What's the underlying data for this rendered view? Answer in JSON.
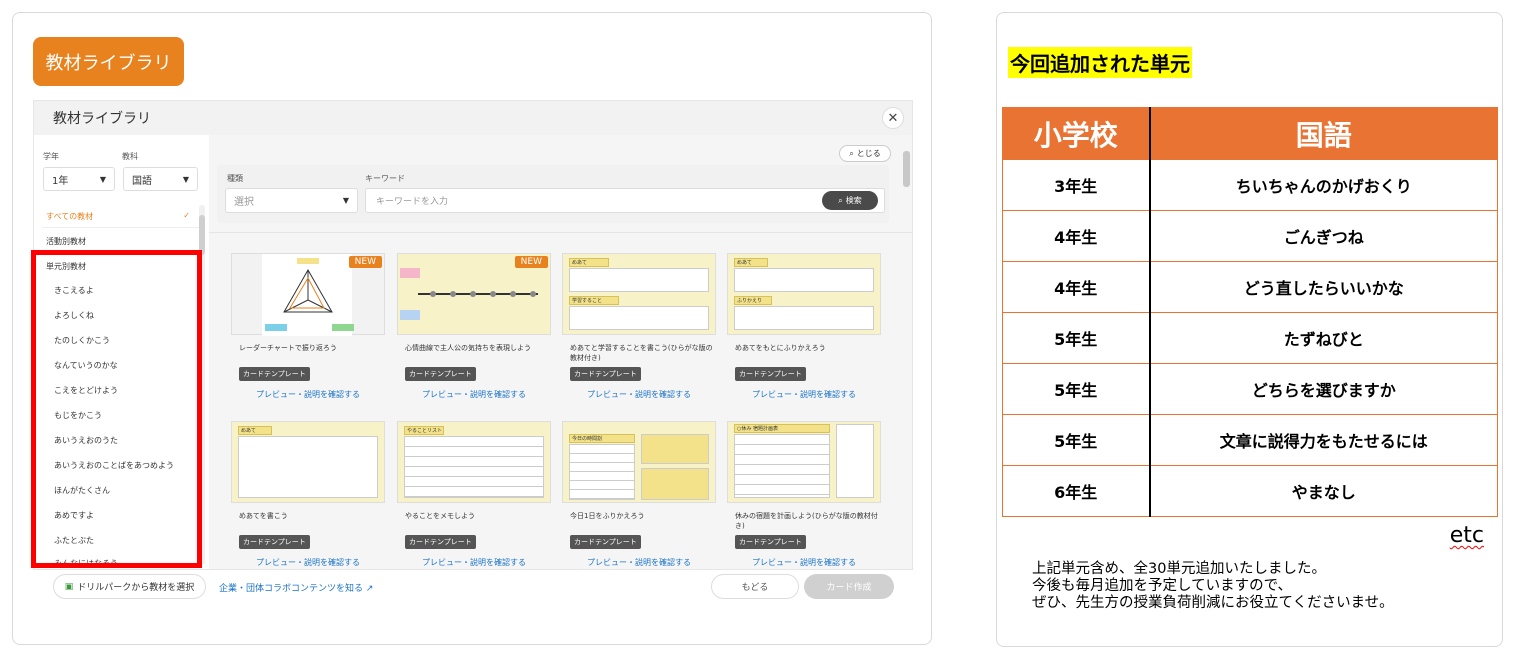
{
  "left": {
    "badge": "教材ライブラリ",
    "modal_title": "教材ライブラリ",
    "close": "✕",
    "filters": {
      "grade_label": "学年",
      "grade_value": "1年",
      "subject_label": "教科",
      "subject_value": "国語"
    },
    "menu": {
      "all": "すべての教材",
      "all_check": "✓",
      "activity": "活動別教材",
      "unit": "単元別教材",
      "units": [
        "きこえるよ",
        "よろしくね",
        "たのしくかこう",
        "なんていうのかな",
        "こえをとどけよう",
        "もじをかこう",
        "あいうえおのうた",
        "あいうえおのことばをあつめよう",
        "ほんがたくさん",
        "あめですよ",
        "ふたとぶた",
        "みんなにはなそう"
      ]
    },
    "search": {
      "toji": "とじる",
      "type_label": "種類",
      "type_value": "選択",
      "keyword_label": "キーワード",
      "keyword_placeholder": "キーワードを入力",
      "search_button": "検索"
    },
    "cards": [
      {
        "title": "レーダーチャートで振り返ろう",
        "tag": "カードテンプレート",
        "link": "プレビュー・説明を確認する",
        "new": "NEW"
      },
      {
        "title": "心情曲線で主人公の気持ちを表現しよう",
        "tag": "カードテンプレート",
        "link": "プレビュー・説明を確認する",
        "new": "NEW"
      },
      {
        "title": "めあてと学習することを書こう(ひらがな版の教材付き)",
        "tag": "カードテンプレート",
        "link": "プレビュー・説明を確認する",
        "hdr": "めあて",
        "hdr2": "学習すること"
      },
      {
        "title": "めあてをもとにふりかえろう",
        "tag": "カードテンプレート",
        "link": "プレビュー・説明を確認する",
        "hdr": "めあて",
        "hdr2": "ふりかえり"
      },
      {
        "title": "めあてを書こう",
        "tag": "カードテンプレート",
        "link": "プレビュー・説明を確認する",
        "hdr": "めあて"
      },
      {
        "title": "やることをメモしよう",
        "tag": "カードテンプレート",
        "link": "プレビュー・説明を確認する",
        "hdr": "やることリスト"
      },
      {
        "title": "今日1日をふりかえろう",
        "tag": "カードテンプレート",
        "link": "プレビュー・説明を確認する",
        "hdr": "今日の時間割"
      },
      {
        "title": "休みの宿題を計画しよう(ひらがな版の教材付き)",
        "tag": "カードテンプレート",
        "link": "プレビュー・説明を確認する",
        "hdr": "○休み 宿題計画表"
      }
    ],
    "bottom": {
      "drill": "ドリルパークから教材を選択",
      "collab": "企業・団体コラボコンテンツを知る",
      "back": "もどる",
      "create": "カード作成"
    }
  },
  "right": {
    "title": "今回追加された単元",
    "headers": [
      "小学校",
      "国語"
    ],
    "rows": [
      [
        "3年生",
        "ちいちゃんのかげおくり"
      ],
      [
        "4年生",
        "ごんぎつね"
      ],
      [
        "4年生",
        "どう直したらいいかな"
      ],
      [
        "5年生",
        "たずねびと"
      ],
      [
        "5年生",
        "どちらを選びますか"
      ],
      [
        "5年生",
        "文章に説得力をもたせるには"
      ],
      [
        "6年生",
        "やまなし"
      ]
    ],
    "etc": "etc",
    "note": [
      "上記単元含め、全30単元追加いたしました。",
      "今後も毎月追加を予定していますので、",
      "ぜひ、先生方の授業負荷削減にお役立てくださいませ。"
    ]
  }
}
